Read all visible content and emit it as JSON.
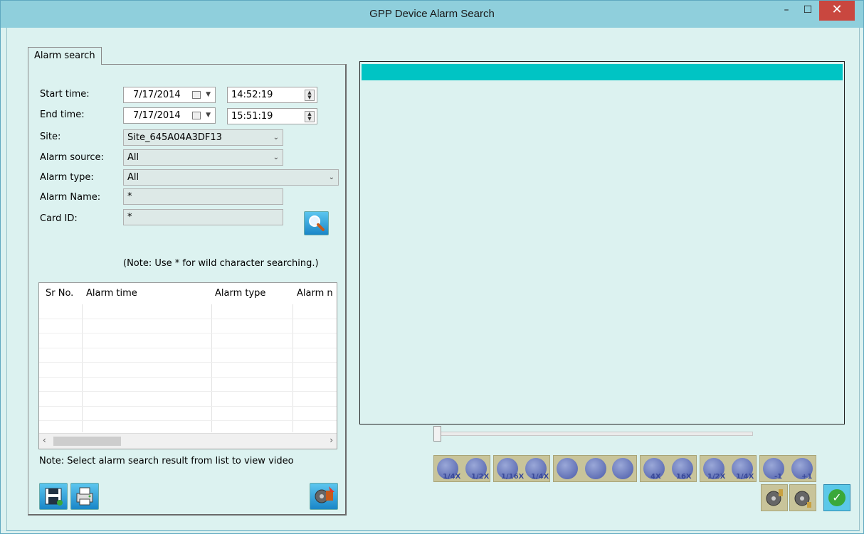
{
  "window": {
    "title": "GPP Device Alarm Search",
    "minimize": "–",
    "maximize": "☐",
    "close": "✕"
  },
  "tab": {
    "label": "Alarm search"
  },
  "form": {
    "start_label": "Start time:",
    "start_date": "7/17/2014",
    "start_time": "14:52:19",
    "end_label": "End time:",
    "end_date": "7/17/2014",
    "end_time": "15:51:19",
    "site_label": "Site:",
    "site_value": "Site_645A04A3DF13",
    "source_label": "Alarm source:",
    "source_value": "All",
    "type_label": "Alarm type:",
    "type_value": "All",
    "name_label": "Alarm Name:",
    "name_value": "*",
    "card_label": "Card ID:",
    "card_value": "*",
    "note": "(Note: Use * for wild character searching.)"
  },
  "table": {
    "columns": [
      "Sr No.",
      "Alarm time",
      "Alarm type",
      "Alarm n"
    ]
  },
  "footer_note": "Note: Select alarm search result from list to view video",
  "playback": {
    "labels": [
      "1/4X",
      "1/2X",
      "1/16X",
      "1/4X",
      "",
      "",
      "",
      "4X",
      "16X",
      "1/2X",
      "1/4X",
      "-1",
      "+1"
    ]
  },
  "colors": {
    "video_header": "#00c4c4",
    "window_bg": "#dcf2f0",
    "close_btn": "#c9473f"
  }
}
